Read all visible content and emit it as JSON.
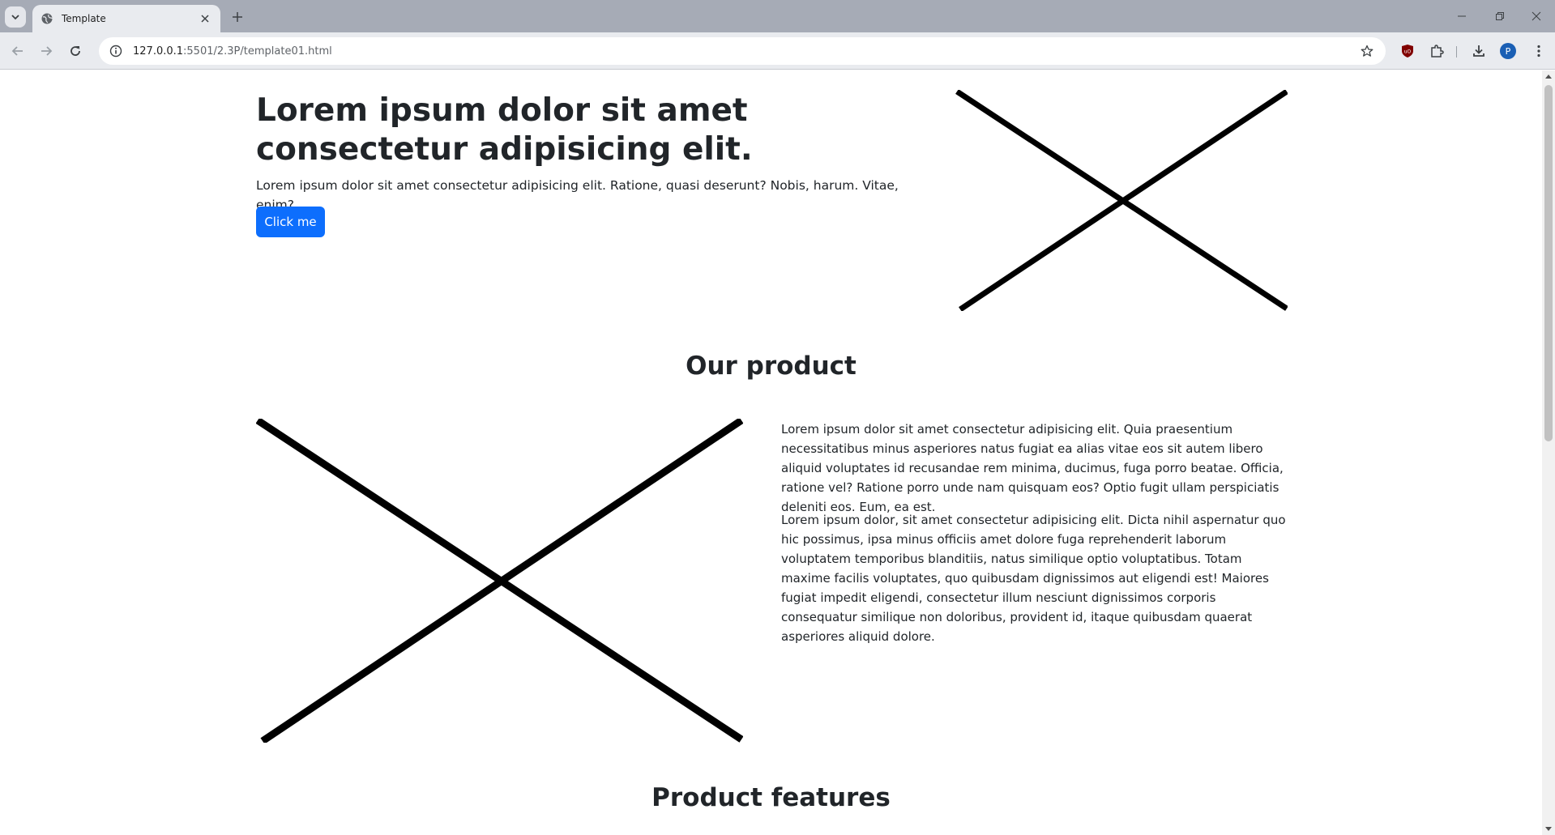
{
  "browser": {
    "tab_title": "Template",
    "url_host": "127.0.0.1",
    "url_rest": ":5501/2.3P/template01.html",
    "profile_initial": "P"
  },
  "hero": {
    "title": "Lorem ipsum dolor sit amet consectetur adipisicing elit.",
    "lead": "Lorem ipsum dolor sit amet consectetur adipisicing elit. Ratione, quasi deserunt? Nobis, harum. Vitae, enim?",
    "button_label": "Click me"
  },
  "product": {
    "title": "Our product",
    "paragraph_1": "Lorem ipsum dolor sit amet consectetur adipisicing elit. Quia praesentium necessitatibus minus asperiores natus fugiat ea alias vitae eos sit autem libero aliquid voluptates id recusandae rem minima, ducimus, fuga porro beatae. Officia, ratione vel? Ratione porro unde nam quisquam eos? Optio fugit ullam perspiciatis deleniti eos. Eum, ea est.",
    "paragraph_2": "Lorem ipsum dolor, sit amet consectetur adipisicing elit. Dicta nihil aspernatur quo hic possimus, ipsa minus officiis amet dolore fuga reprehenderit laborum voluptatem temporibus blanditiis, natus similique optio voluptatibus. Totam maxime facilis voluptates, quo quibusdam dignissimos aut eligendi est! Maiores fugiat impedit eligendi, consectetur illum nesciunt dignissimos corporis consequatur similique non doloribus, provident id, itaque quibusdam quaerat asperiores aliquid dolore."
  },
  "features": {
    "title": "Product features"
  },
  "colors": {
    "primary_button": "#0d6efd",
    "text": "#212529",
    "tabbar": "#a6abb6",
    "toolbar": "#e9ebef"
  }
}
